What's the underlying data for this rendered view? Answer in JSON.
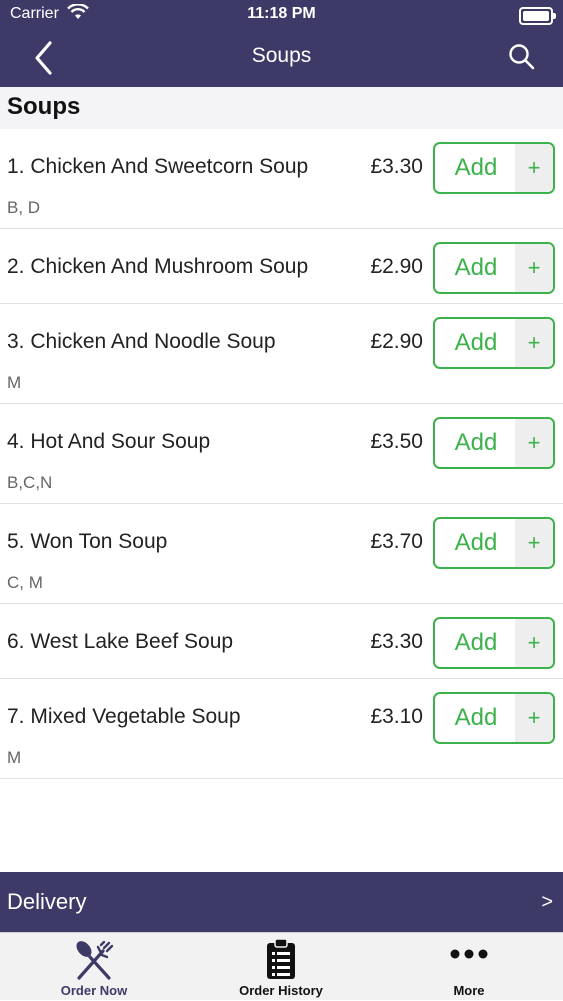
{
  "status_bar": {
    "carrier": "Carrier",
    "time": "11:18 PM"
  },
  "nav": {
    "title": "Soups"
  },
  "section": {
    "title": "Soups"
  },
  "items": [
    {
      "name": "1. Chicken And Sweetcorn Soup",
      "price": "£3.30",
      "allergens": "B, D",
      "add_label": "Add",
      "plus": "+"
    },
    {
      "name": "2. Chicken And Mushroom Soup",
      "price": "£2.90",
      "allergens": "",
      "add_label": "Add",
      "plus": "+"
    },
    {
      "name": "3. Chicken And Noodle Soup",
      "price": "£2.90",
      "allergens": "M",
      "add_label": "Add",
      "plus": "+"
    },
    {
      "name": "4. Hot And Sour Soup",
      "price": "£3.50",
      "allergens": "B,C,N",
      "add_label": "Add",
      "plus": "+"
    },
    {
      "name": "5. Won Ton Soup",
      "price": "£3.70",
      "allergens": "C, M",
      "add_label": "Add",
      "plus": "+"
    },
    {
      "name": "6. West Lake Beef Soup",
      "price": "£3.30",
      "allergens": "",
      "add_label": "Add",
      "plus": "+"
    },
    {
      "name": "7. Mixed Vegetable Soup",
      "price": "£3.10",
      "allergens": "M",
      "add_label": "Add",
      "plus": "+"
    }
  ],
  "delivery": {
    "label": "Delivery",
    "arrow": ">"
  },
  "tabs": [
    {
      "label": "Order Now",
      "icon": "fork-spoon-icon"
    },
    {
      "label": "Order History",
      "icon": "clipboard-list-icon"
    },
    {
      "label": "More",
      "icon": "more-dots-icon"
    }
  ],
  "colors": {
    "primary": "#3d3a67",
    "accent_green": "#3cb24a",
    "section_bg": "#f4f4f6"
  }
}
